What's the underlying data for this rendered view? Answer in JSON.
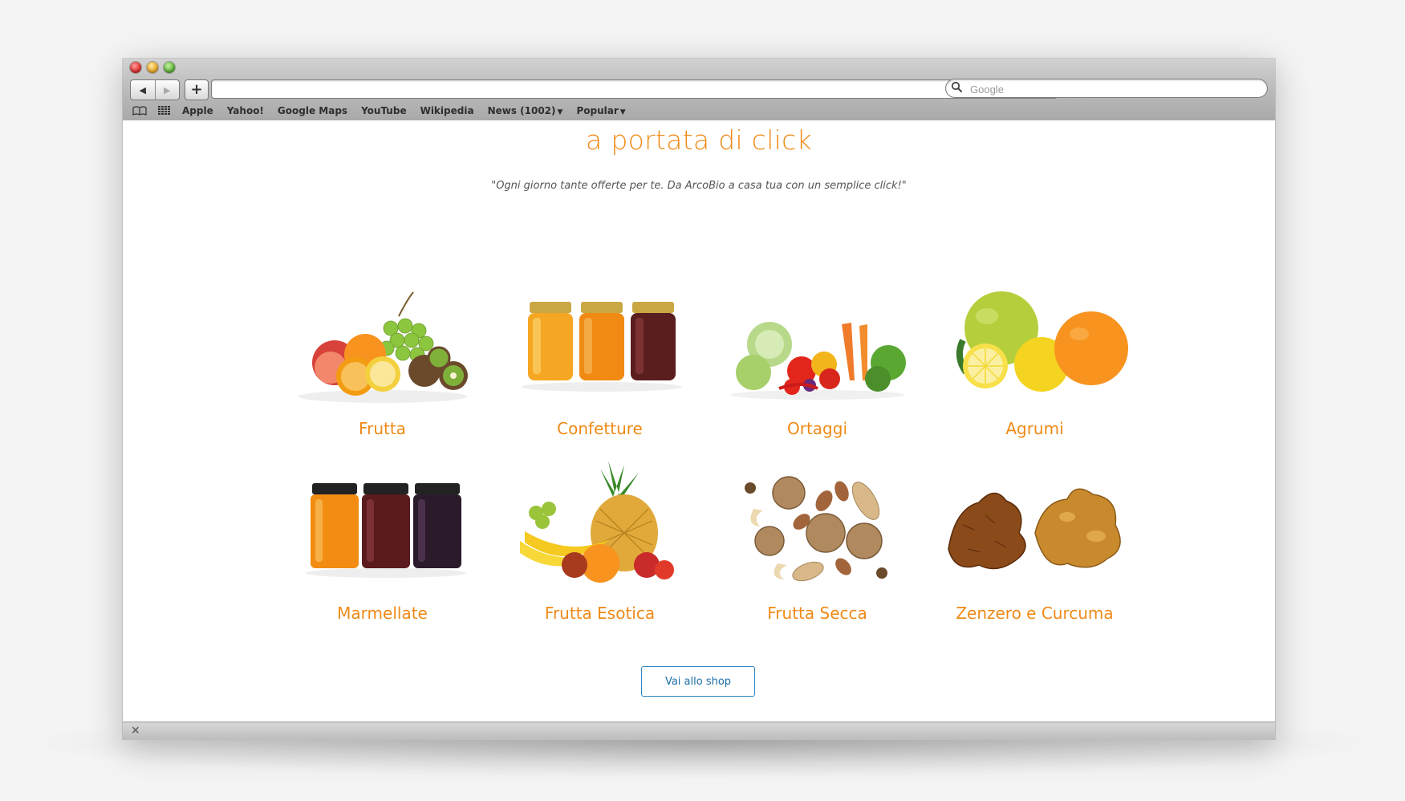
{
  "browser": {
    "nav": {
      "back_icon": "◀",
      "forward_icon": "▶",
      "new_tab_icon": "+"
    },
    "url": "",
    "search": {
      "placeholder": "Google"
    },
    "bookmarks": [
      "Apple",
      "Yahoo!",
      "Google Maps",
      "YouTube",
      "Wikipedia",
      "News (1002)",
      "Popular"
    ],
    "status_close_icon": "×"
  },
  "page": {
    "title": "a portata di click",
    "tagline": "\"Ogni giorno tante offerte per te. Da ArcoBio a casa tua con un semplice click!\"",
    "categories": [
      {
        "label": "Frutta",
        "icon": "fruit-basket-image"
      },
      {
        "label": "Confetture",
        "icon": "jam-jars-image"
      },
      {
        "label": "Ortaggi",
        "icon": "vegetables-image"
      },
      {
        "label": "Agrumi",
        "icon": "citrus-image"
      },
      {
        "label": "Marmellate",
        "icon": "marmalade-jars-image"
      },
      {
        "label": "Frutta Esotica",
        "icon": "exotic-fruit-image"
      },
      {
        "label": "Frutta Secca",
        "icon": "nuts-image"
      },
      {
        "label": "Zenzero e Curcuma",
        "icon": "ginger-turmeric-image"
      }
    ],
    "shop_button": "Vai allo shop"
  },
  "colors": {
    "accent": "#ef8a17",
    "button": "#1c6ea8"
  }
}
